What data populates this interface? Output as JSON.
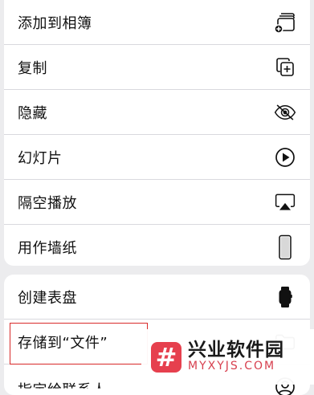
{
  "menu_group_1": {
    "items": [
      {
        "label": "添加到相簿",
        "icon": "add-to-album-icon"
      },
      {
        "label": "复制",
        "icon": "duplicate-icon"
      },
      {
        "label": "隐藏",
        "icon": "eye-slash-icon"
      },
      {
        "label": "幻灯片",
        "icon": "play-circle-icon"
      },
      {
        "label": "隔空播放",
        "icon": "airplay-icon"
      },
      {
        "label": "用作墙纸",
        "icon": "iphone-icon"
      }
    ]
  },
  "menu_group_2": {
    "items": [
      {
        "label": "创建表盘",
        "icon": "watch-icon"
      },
      {
        "label": "存储到“文件”",
        "icon": "folder-icon"
      },
      {
        "label": "指定给联系人",
        "icon": "contact-icon"
      }
    ]
  },
  "watermark": {
    "logo_glyph": "#",
    "title": "兴业软件园",
    "subtitle": "MYXYJS.COM"
  }
}
